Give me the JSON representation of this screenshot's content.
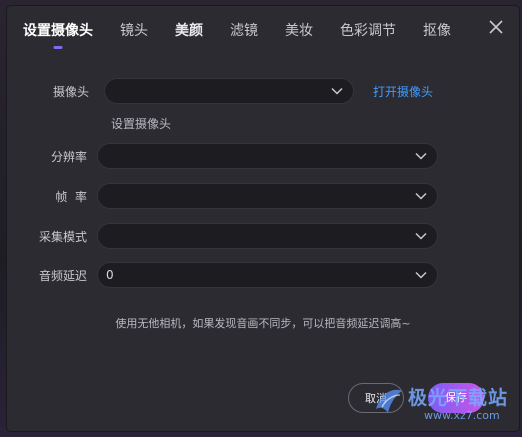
{
  "tabs": [
    {
      "label": "设置摄像头"
    },
    {
      "label": "镜头"
    },
    {
      "label": "美颜"
    },
    {
      "label": "滤镜"
    },
    {
      "label": "美妆"
    },
    {
      "label": "色彩调节"
    },
    {
      "label": "抠像"
    }
  ],
  "form": {
    "camera_label": "摄像头",
    "camera_value": "",
    "open_camera_link": "打开摄像头",
    "camera_sub_label": "设置摄像头",
    "resolution_label": "分辨率",
    "resolution_value": "",
    "framerate_label": "帧  率",
    "framerate_value": "",
    "capture_mode_label": "采集模式",
    "capture_mode_value": "",
    "audio_delay_label": "音频延迟",
    "audio_delay_value": "0"
  },
  "hint": "使用无他相机，如果发现音画不同步，可以把音频延迟调高~",
  "buttons": {
    "cancel": "取消",
    "save": "保存"
  },
  "watermark": {
    "text": "极光下载站",
    "url": "www.xz7.com"
  },
  "colors": {
    "accent": "#7c6cf0",
    "link": "#3f9bff",
    "dialog_bg": "#2b2b31",
    "field_bg": "#1c1c21"
  }
}
